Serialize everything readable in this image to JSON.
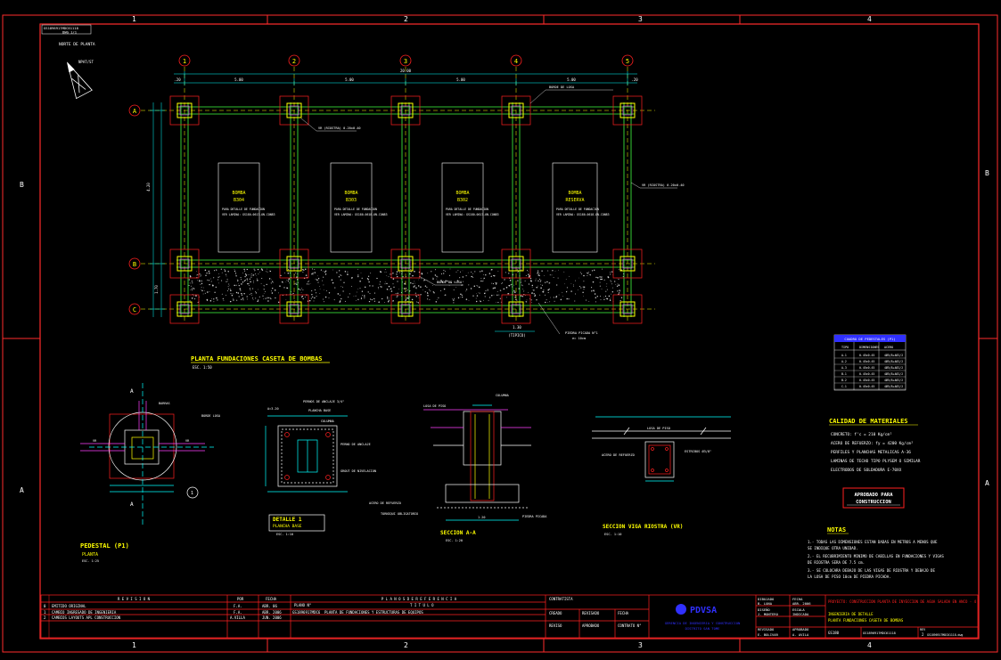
{
  "sheet": {
    "ref_top_left": [
      "GS1896917MDC61118",
      "DWG 1/1"
    ],
    "grid_cols": [
      "1",
      "2",
      "3",
      "4"
    ],
    "grid_rows": [
      "B",
      "A"
    ]
  },
  "plan": {
    "north_label": "NORTE DE PLANTA",
    "north_sub": "NPAT/ST",
    "axes_x": [
      "1",
      "2",
      "3",
      "4",
      "5"
    ],
    "axes_y": [
      "A",
      "B",
      "C"
    ],
    "dim_total": "20.00",
    "dim_spans": [
      "5.00",
      "5.00",
      "5.00",
      "5.00"
    ],
    "dim_edges": [
      ".20",
      ".20"
    ],
    "dim_side": [
      "4.20",
      "1.70"
    ],
    "label_border": "BORDE DE LOSA",
    "label_beam_v1": "VR (RIOSTRA) 0.20x0.40",
    "label_beam_v2": "VR (RIOSTRA) 0.20x0.40",
    "label_slab": "BORDE DE LOSA",
    "label_stone": "PIEDRA PICADA N°1",
    "label_stone2": "e= 10cm",
    "dim_bottom": "1.30",
    "dim_bottom2": "(TIPICO)",
    "pumps": [
      {
        "name": "BOMBA",
        "code": "B304",
        "note1": "PARA DETALLE DE FUNDACION",
        "note2": "VER LAMINA: GS180-0617-ON-CON83"
      },
      {
        "name": "BOMBA",
        "code": "B303",
        "note1": "PARA DETALLE DE FUNDACION",
        "note2": "VER LAMINA: GS180-0618-ON-CON83"
      },
      {
        "name": "BOMBA",
        "code": "B302",
        "note1": "PARA DETALLE DE FUNDACION",
        "note2": "VER LAMINA: GS180-0617-ON-CON83"
      },
      {
        "name": "BOMBA",
        "code": "RESERVA",
        "note1": "PARA DETALLE DE FUNDACION",
        "note2": "VER LAMINA: GS180-0618-ON-CON83"
      }
    ],
    "title": "PLANTA FUNDACIONES CASETA DE BOMBAS",
    "scale": "ESC. 1:50"
  },
  "details": {
    "d1_title": "PEDESTAL (P1)",
    "d1_sub": "PLANTA",
    "d1_scale": "ESC. 1:25",
    "d1_labels": [
      "BARRAS",
      "BORDE LOSA",
      "VR",
      "VR",
      "A",
      "A",
      "1"
    ],
    "d2_title": "DETALLE 1",
    "d2_sub": "PLANCHA BASE",
    "d2_scale": "ESC. 1:10",
    "d2_labels": [
      "PERNOS DE ANCLAJE 3/4\"",
      "PLANCHA BASE",
      "COLUMNA",
      "PERNO DE ANCLAJE",
      "GROUT DE NIVELACION",
      "A=3.20"
    ],
    "d3_title": "SECCION A-A",
    "d3_scale": "ESC. 1:20",
    "d3_labels": [
      "COLUMNA",
      "LOSA DE PISO",
      "ACERO DE REFUERZO",
      "TORNIQUI OBLIGATORIO",
      "PIEDRA PICADA",
      "1.20"
    ],
    "d4_title": "SECCION VIGA RIOSTRA (VR)",
    "d4_scale": "ESC. 1:10",
    "d4_labels": [
      "LOSA DE PISO",
      "ACERO DE REFUERZO",
      "ESTRIBOS Ø3/8\""
    ]
  },
  "legend_table": {
    "header": "CUADRO DE PEDESTALES (P1)",
    "cols": [
      "TIPO",
      "DIMENSIONES",
      "ACERO"
    ],
    "rows": [
      [
        "A-1",
        "0.45x0.45",
        "4Ø5/8+4Ø1/2"
      ],
      [
        "A-2",
        "0.45x0.45",
        "4Ø5/8+4Ø1/2"
      ],
      [
        "A-3",
        "0.45x0.45",
        "4Ø5/8+4Ø1/2"
      ],
      [
        "B-1",
        "0.45x0.45",
        "4Ø5/8+4Ø1/2"
      ],
      [
        "B-2",
        "0.45x0.45",
        "4Ø5/8+4Ø1/2"
      ],
      [
        "C-1",
        "0.45x0.45",
        "4Ø5/8+4Ø1/2"
      ]
    ]
  },
  "materials": {
    "title": "CALIDAD DE MATERIALES",
    "lines": [
      "CONCRETO: f'c = 210 Kg/cm²",
      "ACERO DE REFUERZO: fy = 4200 Kg/cm²",
      "PERFILES Y PLANCHAS METALICAS A-36",
      "LAMINAS DE TECHO TIPO PLYSEM O SIMILAR",
      "ELECTRODOS DE SOLDADURA E-70XX"
    ]
  },
  "stamp": {
    "line1": "APROBADO PARA",
    "line2": "CONSTRUCCION"
  },
  "notes": {
    "title": "NOTAS",
    "items": [
      "1.- TODAS LAS DIMENSIONES ESTAN DADAS EN METROS A MENOS QUE",
      "    SE INDIQUE OTRA UNIDAD.",
      "2.- EL RECUBRIMIENTO MINIMO DE CABILLAS EN FUNDACIONES Y VIGAS",
      "    DE RIOSTRA SERA DE 7.5 cm.",
      "3.- SE COLOCARA DEBAJO DE LAS VIGAS DE RIOSTRA Y DEBAJO DE",
      "    LA LOSA DE PISO 10cm DE PIEDRA PICADA."
    ]
  },
  "title_block": {
    "rev_header": "R E V I S I O N",
    "rev_cols": [
      "POR",
      "FECHA"
    ],
    "rev_rows": [
      [
        "0",
        "EMITIDO ORIGINAL",
        "F.A.",
        "ABR. 06"
      ],
      [
        "1",
        "CAMBIO INGRESADO DE INGENIERIA",
        "F.A.",
        "ABR. 2006"
      ],
      [
        "2",
        "CAMBIOS LAYOUTS APL CONSTRUCCION",
        "A.VILLA",
        "JUN. 2006"
      ]
    ],
    "ref_header": "P L A N O S   D E   R E F E R E N C I A",
    "ref_cols": [
      "PLANO N°",
      "T I T U L O"
    ],
    "ref_rows": [
      [
        "GS1896917MDC6",
        "PLANTA DE FUNDACIONES Y ESTRUCTURAS DE EQUIPOS"
      ]
    ],
    "company_cells": [
      "CONTRATISTA",
      "CREADO",
      "REVISADO",
      "FECHA",
      "REVISO",
      "APROBADO",
      "CONTRATO N°"
    ],
    "logo": "PDVSA",
    "dept": [
      "GERENCIA DE INGENIERIA Y CONSTRUCCION",
      "DISTRITO SAN TOME"
    ],
    "people": [
      [
        "DIBUJADO",
        "B. LUNA"
      ],
      [
        "DISEÑO",
        "J. MONTERO"
      ],
      [
        "REVISADO",
        "E. BOLIVAR"
      ]
    ],
    "fields": [
      [
        "FECHA",
        "ABR. 2006"
      ],
      [
        "ESCALA",
        "INDICADA"
      ],
      [
        "APROBADO",
        "A. AVILA"
      ]
    ],
    "project": "PROYECTO: CONSTRUCCION PLANTA DE INYECCION DE AGUA SALADA EN ANCO - 4",
    "discipline": "INGENIERIA DE DETALLE",
    "drawing_title": "PLANTA FUNDACIONES CASETA DE BOMBAS",
    "numbers": [
      "GS180",
      "GS1896917MDC61118",
      "REV",
      "2",
      "GS1896917MDC61118.dwg"
    ]
  },
  "colors": {
    "frame": "#ff2b2b",
    "yellow": "#ffff00",
    "white": "#ffffff",
    "cyan": "#00ffff",
    "green": "#40ff40",
    "magenta": "#ff40ff",
    "red": "#ff2020",
    "gray": "#9a9a9a",
    "blue": "#3030ff"
  }
}
